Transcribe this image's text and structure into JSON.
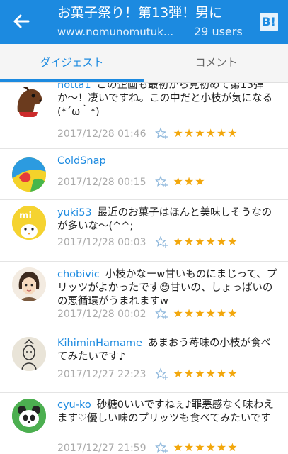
{
  "header": {
    "title": "お菓子祭り！第13弾！男に",
    "url": "www.nomunomutuk...",
    "users": "29 users",
    "logo": "B!"
  },
  "tabs": [
    {
      "label": "ダイジェスト",
      "active": true
    },
    {
      "label": "コメント",
      "active": false
    }
  ],
  "comments": [
    {
      "user": "hotta1",
      "text": "この企画も最初から見初めて第13弾か〜！凄いですね。この中だと小枝が気になる(*´ω｀*)",
      "date": "2017/12/28 01:46",
      "stars": "★★★★★★",
      "avatar": "horse-avatar"
    },
    {
      "user": "ColdSnap",
      "text": "",
      "date": "2017/12/28 00:15",
      "stars": "★★★",
      "avatar": "colorful-circle-avatar"
    },
    {
      "user": "yuki53",
      "text": "最近のお菓子はほんと美味しそうなのが多いな〜(^^;",
      "date": "2017/12/28 00:03",
      "stars": "★★★★★★",
      "avatar": "yellow-chick-avatar"
    },
    {
      "user": "chobivic",
      "text": "小枝かなーw甘いものにまじって、プリッツがよかったです😊甘いの、しょっぱいのの悪循環がうまれますw",
      "date": "2017/12/28 00:02",
      "stars": "★★★★★★",
      "avatar": "girl-avatar"
    },
    {
      "user": "KihiminHamame",
      "text": "あまおう苺味の小枝が食べてみたいです♪",
      "date": "2017/12/27 22:23",
      "stars": "★★★★★★",
      "avatar": "drawing-avatar"
    },
    {
      "user": "cyu-ko",
      "text": "砂糖0いいですねぇ♪罪悪感なく味わえます♡優しい味のプリッツも食べてみたいです",
      "date": "2017/12/27 21:59",
      "stars": "★★★★★★",
      "avatar": "panda-avatar"
    }
  ],
  "colors": {
    "accent": "#1c8ae0",
    "star": "#f2a70c"
  }
}
